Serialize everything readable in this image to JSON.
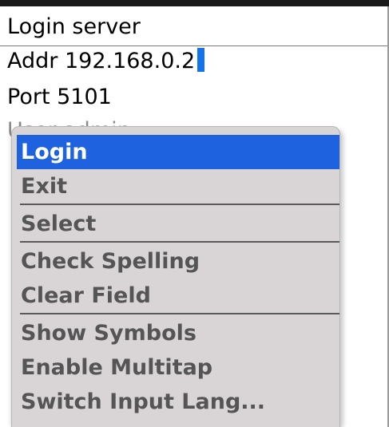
{
  "screen": {
    "title": "Login server",
    "fields": {
      "addr": "Addr 192.168.0.2",
      "port": "Port 5101",
      "user": "User admin"
    }
  },
  "menu": {
    "items": [
      {
        "label": "Login",
        "selected": true
      },
      {
        "label": "Exit"
      },
      {
        "label": "Select"
      },
      {
        "label": "Check Spelling"
      },
      {
        "label": "Clear Field"
      },
      {
        "label": "Show Symbols"
      },
      {
        "label": "Enable Multitap"
      },
      {
        "label": "Switch Input Lang..."
      }
    ]
  },
  "colors": {
    "selection": "#1e62df",
    "cursor": "#1473e6",
    "menu_background": "#d9d4d6"
  }
}
